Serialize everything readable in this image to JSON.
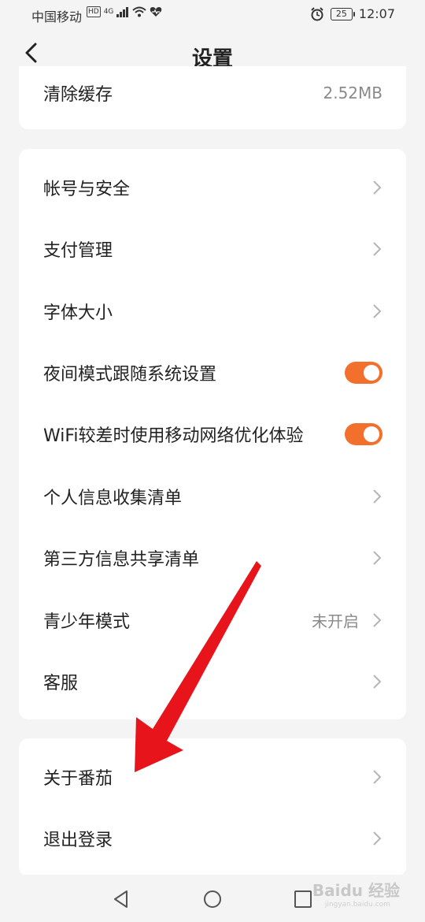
{
  "status_bar": {
    "carrier": "中国移动",
    "hd": "HD",
    "network": "4G",
    "battery": "25",
    "time": "12:07"
  },
  "header": {
    "title": "设置"
  },
  "top_card": {
    "clear_cache_label": "清除缓存",
    "clear_cache_value": "2.52MB"
  },
  "main_card": {
    "items": [
      {
        "label": "帐号与安全"
      },
      {
        "label": "支付管理"
      },
      {
        "label": "字体大小"
      },
      {
        "label": "夜间模式跟随系统设置",
        "toggle": true
      },
      {
        "label": "WiFi较差时使用移动网络优化体验",
        "toggle": true
      },
      {
        "label": "个人信息收集清单"
      },
      {
        "label": "第三方信息共享清单"
      },
      {
        "label": "青少年模式",
        "value": "未开启"
      },
      {
        "label": "客服"
      }
    ]
  },
  "bottom_card": {
    "items": [
      {
        "label": "关于番茄"
      },
      {
        "label": "退出登录"
      }
    ]
  },
  "watermark": {
    "text": "Baidu 经验",
    "sub": "jingyan.baidu.com"
  },
  "colors": {
    "accent": "#f36f2c",
    "annotation_arrow": "#e8141b",
    "background": "#f4f4f4"
  }
}
